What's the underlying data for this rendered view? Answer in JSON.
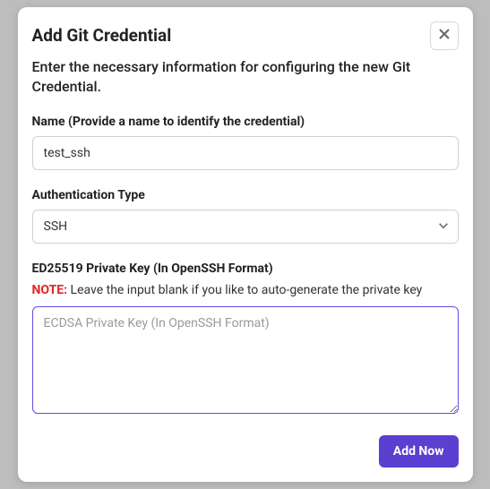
{
  "modal": {
    "title": "Add Git Credential",
    "subtitle": "Enter the necessary information for configuring the new Git Credential."
  },
  "fields": {
    "name": {
      "label": "Name (Provide a name to identify the credential)",
      "value": "test_ssh"
    },
    "auth_type": {
      "label": "Authentication Type",
      "value": "SSH"
    },
    "private_key": {
      "label": "ED25519 Private Key (In OpenSSH Format)",
      "note_prefix": "NOTE:",
      "note_text": " Leave the input blank if you like to auto-generate the private key",
      "placeholder": "ECDSA Private Key (In OpenSSH Format)",
      "value": ""
    }
  },
  "footer": {
    "submit_label": "Add Now"
  }
}
